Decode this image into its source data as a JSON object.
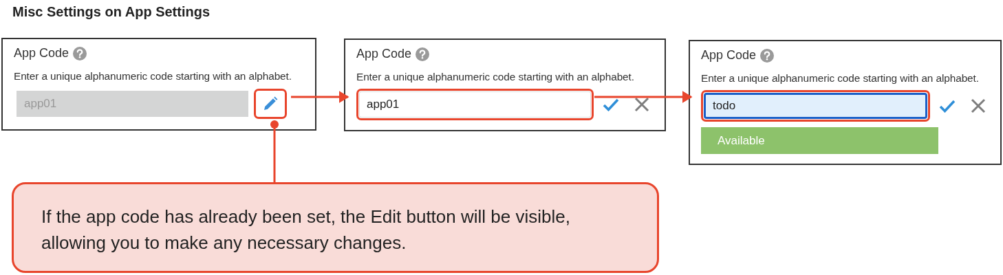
{
  "title": "Misc Settings on App Settings",
  "panels": [
    {
      "label": "App Code",
      "description": "Enter a unique alphanumeric code starting with an alphabet.",
      "field": {
        "value": "app01",
        "disabled": true,
        "focused": false,
        "highlighted": false
      },
      "actions": [
        {
          "kind": "edit",
          "highlighted": true
        }
      ]
    },
    {
      "label": "App Code",
      "description": "Enter a unique alphanumeric code starting with an alphabet.",
      "field": {
        "value": "app01",
        "disabled": false,
        "focused": false,
        "highlighted": true
      },
      "actions": [
        {
          "kind": "confirm",
          "highlighted": false
        },
        {
          "kind": "cancel",
          "highlighted": false
        }
      ]
    },
    {
      "label": "App Code",
      "description": "Enter a unique alphanumeric code starting with an alphabet.",
      "field": {
        "value": "todo",
        "disabled": false,
        "focused": true,
        "highlighted": true
      },
      "actions": [
        {
          "kind": "confirm",
          "highlighted": false
        },
        {
          "kind": "cancel",
          "highlighted": false
        }
      ],
      "status": "Available"
    }
  ],
  "callout": {
    "text": "If the app code has already been set, the Edit button will be visible, allowing you to make any necessary changes."
  }
}
